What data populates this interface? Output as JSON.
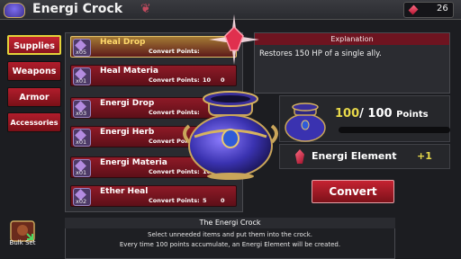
{
  "header": {
    "title": "Energi Crock",
    "currency_value": "26"
  },
  "tabs": [
    {
      "label": "Supplies",
      "active": true
    },
    {
      "label": "Weapons"
    },
    {
      "label": "Armor"
    },
    {
      "label": "Accessories"
    }
  ],
  "items": [
    {
      "name": "Heal Drop",
      "qty": "x05",
      "convert_label": "Convert Points:",
      "points": "",
      "zero": "",
      "selected": true
    },
    {
      "name": "Heal Materia",
      "qty": "x01",
      "convert_label": "Convert Points:",
      "points": "10",
      "zero": "0"
    },
    {
      "name": "Energi Drop",
      "qty": "x03",
      "convert_label": "Convert Points:",
      "points": "",
      "zero": ""
    },
    {
      "name": "Energi Herb",
      "qty": "x01",
      "convert_label": "Convert Points:",
      "points": "",
      "zero": ""
    },
    {
      "name": "Energi Materia",
      "qty": "x01",
      "convert_label": "Convert Points:",
      "points": "10",
      "zero": "0"
    },
    {
      "name": "Ether Heal",
      "qty": "x02",
      "convert_label": "Convert Points:",
      "points": "5",
      "zero": "0"
    }
  ],
  "explanation": {
    "header": "Explanation",
    "text": "Restores 150 HP of a single ally."
  },
  "points": {
    "current": "100",
    "separator": "/",
    "max": "100",
    "unit": "Points",
    "fill_fraction": 1.0
  },
  "element": {
    "name": "Energi Element",
    "gain": "+1"
  },
  "convert_button": "Convert",
  "info": {
    "title": "The Energi Crock",
    "line1": "Select unneeded items and put them into the crock.",
    "line2": "Every time 100 points accumulate, an Energi Element will be created."
  },
  "bulk_set": "Bulk Set",
  "colors": {
    "accent_red": "#b11d2c",
    "gold": "#e8d94a",
    "gem": "#e0304e"
  }
}
